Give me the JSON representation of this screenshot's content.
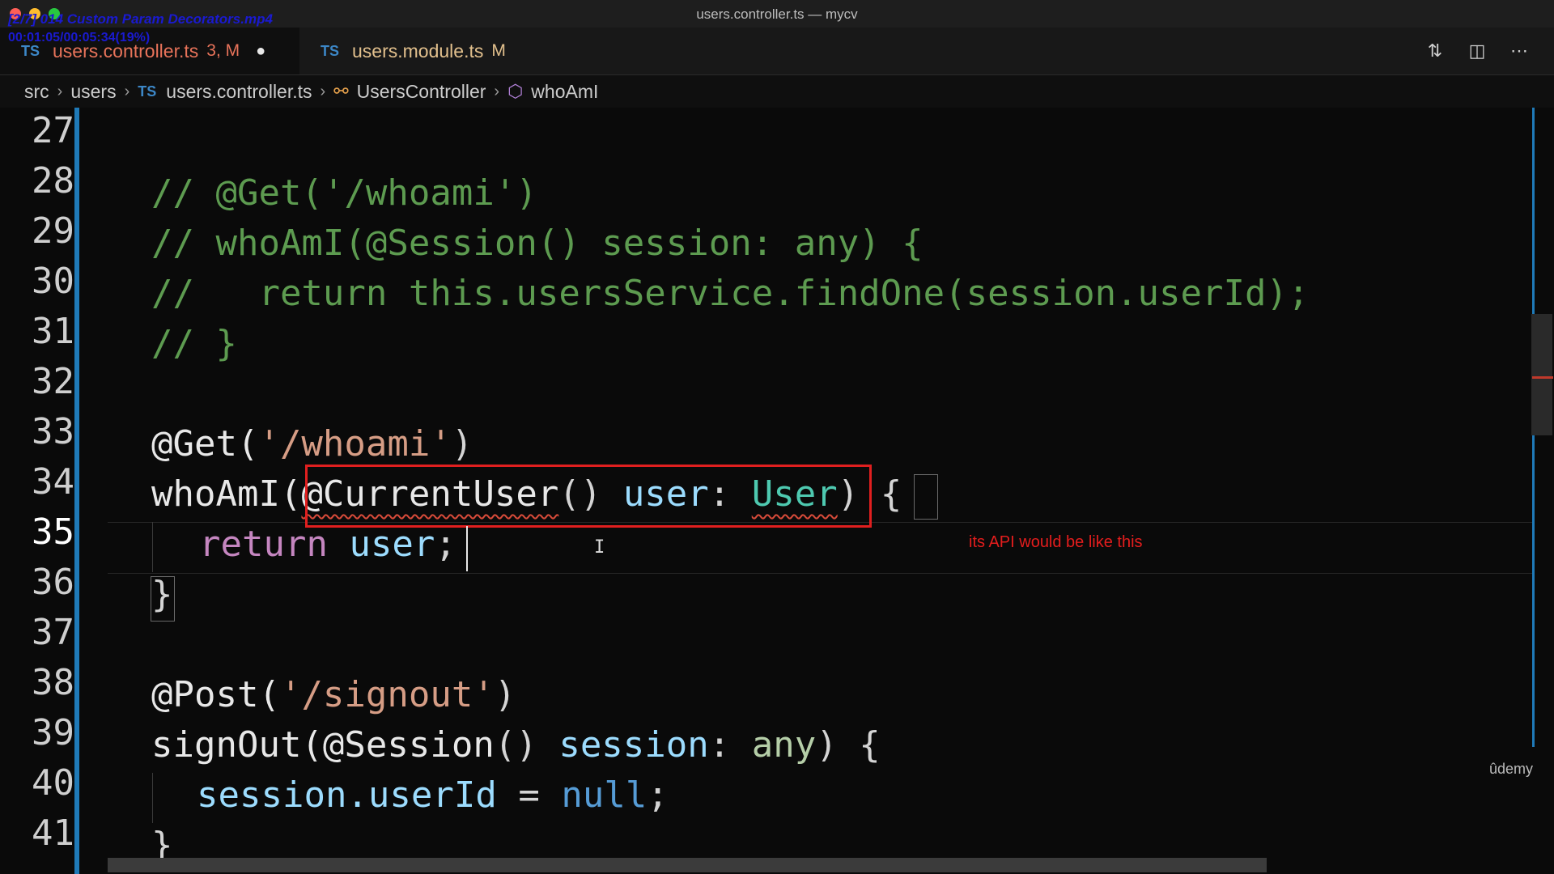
{
  "window": {
    "title": "users.controller.ts — mycv",
    "overlay_file": "[2/7] 014 Custom Param Decorators.mp4",
    "overlay_time": "00:01:05/00:05:34(19%)"
  },
  "tabs": [
    {
      "lang": "TS",
      "name": "users.controller.ts",
      "status": "3, M",
      "dirty": true
    },
    {
      "lang": "TS",
      "name": "users.module.ts",
      "status": "M",
      "dirty": false
    }
  ],
  "breadcrumb": {
    "src": "src",
    "users": "users",
    "lang": "TS",
    "file": "users.controller.ts",
    "class": "UsersController",
    "method": "whoAmI"
  },
  "editor": {
    "line_numbers": [
      "27",
      "28",
      "29",
      "30",
      "31",
      "32",
      "33",
      "34",
      "35",
      "36",
      "37",
      "38",
      "39",
      "40",
      "41"
    ],
    "current_line": "35",
    "lines": {
      "l28": "// @Get('/whoami')",
      "l29": "// whoAmI(@Session() session: any) {",
      "l30": "//   return this.usersService.findOne(session.userId);",
      "l31": "// }",
      "l33_dec": "@Get(",
      "l33_str": "'/whoami'",
      "l33_end": ")",
      "l34_fn": "whoAmI(",
      "l34_dec": "@CurrentUser",
      "l34_paren": "() ",
      "l34_var": "user",
      "l34_colon": ": ",
      "l34_type": "User",
      "l34_end": ") {",
      "l35_kw": "return",
      "l35_var": "user",
      "l35_end": ";",
      "l36": "}",
      "l38_dec": "@Post(",
      "l38_str": "'/signout'",
      "l38_end": ")",
      "l39_fn": "signOut(",
      "l39_dec": "@Session",
      "l39_paren": "() ",
      "l39_var": "session",
      "l39_colon": ": ",
      "l39_type": "any",
      "l39_end": ") {",
      "l40_var": "session.userId",
      "l40_eq": " = ",
      "l40_null": "null",
      "l40_end": ";",
      "l41": "}"
    }
  },
  "annotation": {
    "text": "its API would be like this",
    "color": "#e41d1d"
  },
  "watermark": "ûdemy",
  "colors": {
    "accent": "#1f7ab8",
    "modified_tab": "#e8735a",
    "comment": "#5d9b50"
  }
}
